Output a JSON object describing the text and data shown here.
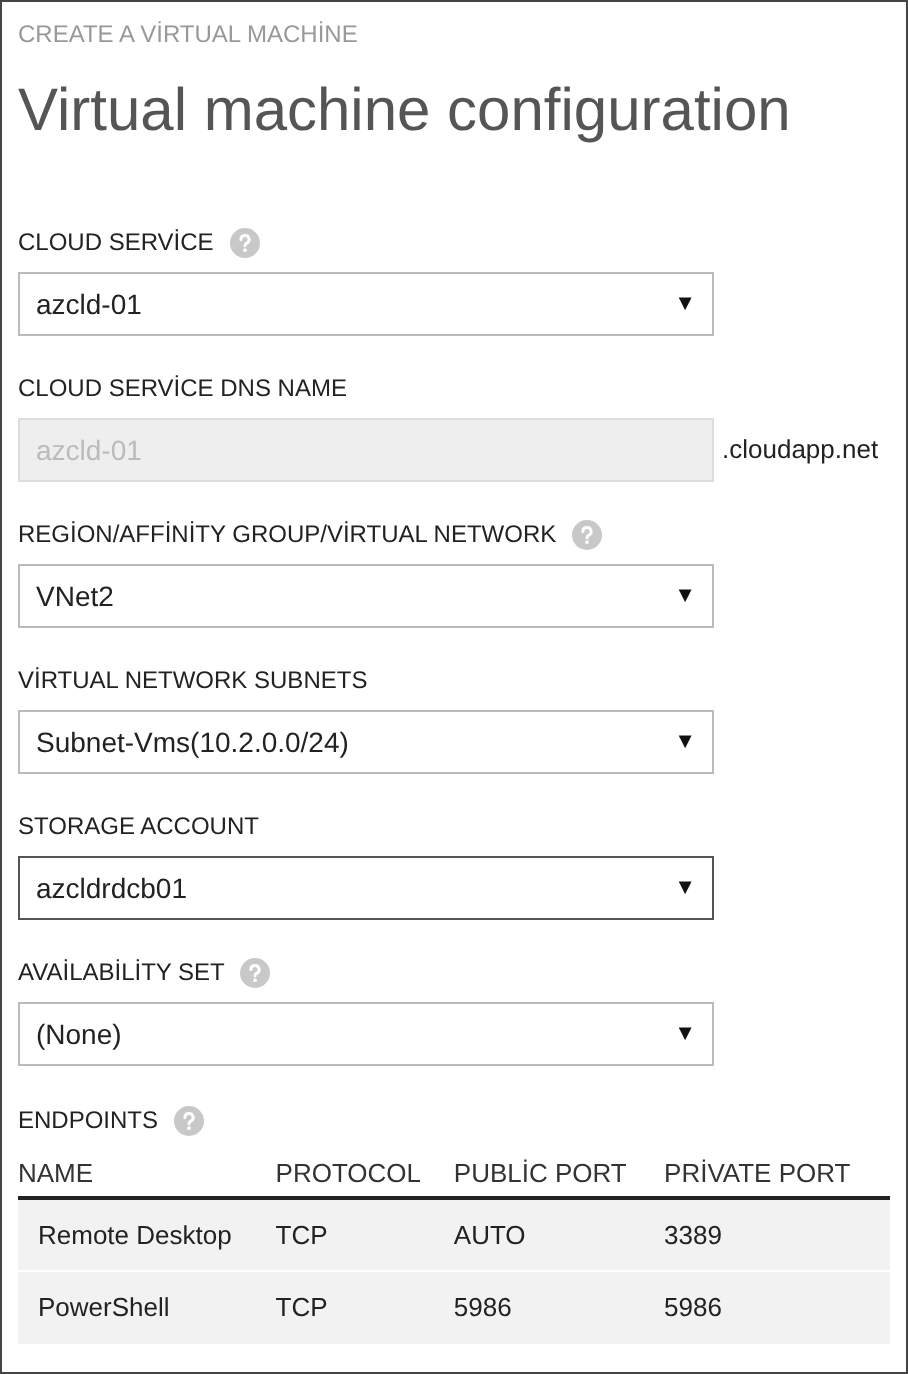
{
  "header": {
    "wizard_title": "CREATE A VİRTUAL MACHİNE",
    "title": "Virtual machine configuration"
  },
  "fields": [
    {
      "kind": "select",
      "label": "CLOUD SERVİCE",
      "help": true,
      "value": "azcld-01",
      "focused": false,
      "caret": "▼"
    },
    {
      "kind": "text",
      "label": "CLOUD SERVİCE DNS NAME",
      "help": false,
      "value": "azcld-01",
      "disabled": true,
      "suffix": ".cloudapp.net"
    },
    {
      "kind": "select",
      "label": "REGİON/AFFİNİTY GROUP/VİRTUAL NETWORK",
      "help": true,
      "value": "VNet2",
      "focused": false,
      "caret": "▼"
    },
    {
      "kind": "select",
      "label": "VİRTUAL NETWORK SUBNETS",
      "help": false,
      "value": "Subnet-Vms(10.2.0.0/24)",
      "focused": false,
      "caret": "▼"
    },
    {
      "kind": "select",
      "label": "STORAGE ACCOUNT",
      "help": false,
      "value": "azcldrdcb01",
      "focused": true,
      "caret": "▼"
    },
    {
      "kind": "select",
      "label": "AVAİLABİLİTY SET",
      "help": true,
      "value": "(None)",
      "focused": false,
      "caret": "▼"
    }
  ],
  "endpoints": {
    "label": "ENDPOINTS",
    "help": true,
    "columns": [
      "NAME",
      "PROTOCOL",
      "PUBLİC PORT",
      "PRİVATE PORT"
    ],
    "rows": [
      [
        "Remote Desktop",
        "TCP",
        "AUTO",
        "3389"
      ],
      [
        "PowerShell",
        "TCP",
        "5986",
        "5986"
      ]
    ]
  }
}
